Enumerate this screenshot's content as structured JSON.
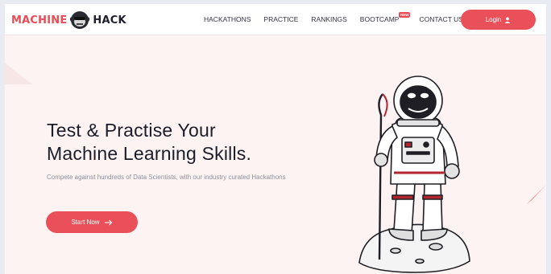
{
  "brand": {
    "name_left": "MACHINE",
    "name_right": "HACK",
    "accent": "#e9505a"
  },
  "nav": {
    "links": [
      {
        "label": "HACKATHONS"
      },
      {
        "label": "PRACTICE"
      },
      {
        "label": "RANKINGS"
      },
      {
        "label": "BOOTCAMP",
        "badge": "NEW"
      },
      {
        "label": "CONTACT US"
      }
    ],
    "login_label": "Login"
  },
  "hero": {
    "title_line1": "Test & Practise Your",
    "title_line2": "Machine Learning Skills.",
    "subtitle": "Compete against hundreds of Data Scientists, with our industry curated Hackathons",
    "cta_label": "Start Now",
    "cta_icon": "arrow-right-icon"
  }
}
